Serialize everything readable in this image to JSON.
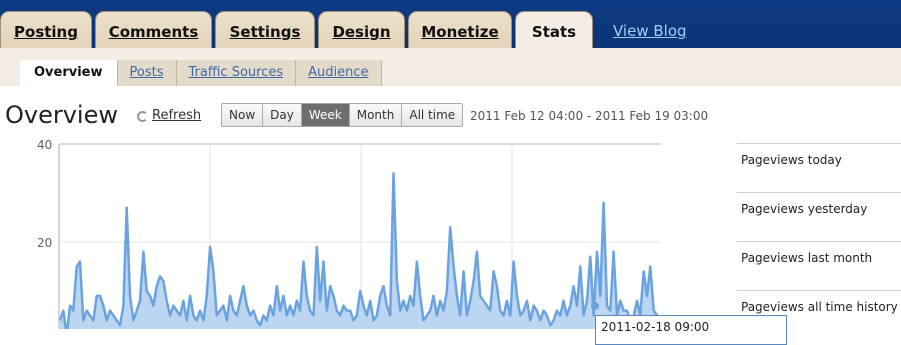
{
  "header": {
    "tabs": [
      {
        "label": "Posting"
      },
      {
        "label": "Comments"
      },
      {
        "label": "Settings"
      },
      {
        "label": "Design"
      },
      {
        "label": "Monetize"
      },
      {
        "label": "Stats",
        "active": true
      }
    ],
    "view_blog": "View Blog"
  },
  "subnav": {
    "items": [
      {
        "label": "Overview",
        "active": true
      },
      {
        "label": "Posts"
      },
      {
        "label": "Traffic Sources"
      },
      {
        "label": "Audience"
      }
    ]
  },
  "overview": {
    "title": "Overview",
    "refresh": "Refresh",
    "ranges": [
      "Now",
      "Day",
      "Week",
      "Month",
      "All time"
    ],
    "selected_range": "Week",
    "date_range": "2011 Feb 12 04:00 - 2011 Feb 19 03:00"
  },
  "stats": [
    {
      "label": "Pageviews today"
    },
    {
      "label": "Pageviews yesterday"
    },
    {
      "label": "Pageviews last month"
    },
    {
      "label": "Pageviews all time history"
    }
  ],
  "tooltip": {
    "text": "2011-02-18 09:00"
  },
  "chart_data": {
    "type": "area",
    "y_ticks": [
      "40",
      "20"
    ],
    "ylim": [
      0,
      40
    ],
    "grid": true,
    "line_color": "#6aa3e0",
    "fill_color": "#bcd6f2",
    "values": [
      4,
      6,
      1,
      7,
      6,
      15,
      16,
      4,
      6,
      5,
      4,
      9,
      9,
      7,
      4,
      6,
      5,
      4,
      3,
      7,
      27,
      9,
      4,
      6,
      8,
      18,
      10,
      9,
      7,
      11,
      13,
      12,
      8,
      5,
      7,
      6,
      5,
      8,
      4,
      9,
      5,
      4,
      6,
      4,
      9,
      19,
      14,
      5,
      6,
      7,
      4,
      9,
      6,
      5,
      8,
      11,
      7,
      5,
      6,
      4,
      3,
      5,
      4,
      7,
      5,
      11,
      6,
      9,
      5,
      7,
      5,
      8,
      6,
      16,
      9,
      6,
      5,
      19,
      8,
      16,
      6,
      11,
      9,
      6,
      5,
      7,
      6,
      6,
      4,
      5,
      10,
      7,
      5,
      8,
      4,
      5,
      9,
      11,
      7,
      5,
      34,
      12,
      6,
      8,
      6,
      9,
      7,
      16,
      9,
      4,
      5,
      6,
      9,
      5,
      8,
      6,
      10,
      23,
      15,
      9,
      5,
      14,
      5,
      8,
      12,
      18,
      9,
      8,
      7,
      6,
      14,
      11,
      6,
      5,
      8,
      5,
      16,
      9,
      5,
      6,
      8,
      4,
      7,
      6,
      4,
      6,
      5,
      3,
      4,
      6,
      5,
      8,
      5,
      7,
      11,
      7,
      15,
      5,
      8,
      17,
      5,
      18,
      9,
      28,
      7,
      6,
      18,
      5,
      8,
      6,
      6,
      4,
      5,
      8,
      5,
      14,
      9,
      15,
      6,
      5
    ]
  }
}
